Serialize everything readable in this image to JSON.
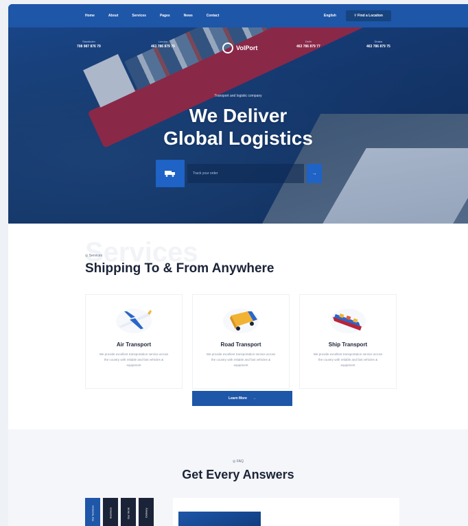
{
  "nav": {
    "items": [
      "Home",
      "About",
      "Services",
      "Pages",
      "News",
      "Contact"
    ],
    "language": "English",
    "cta": "Find a Location"
  },
  "contacts": [
    {
      "label": "Stockholm",
      "number": "708 987 876 79"
    },
    {
      "label": "London",
      "number": "463 786 879 79"
    },
    {
      "label": "Delhi",
      "number": "463 786 879 77"
    },
    {
      "label": "Dhaka",
      "number": "463 786 879 75"
    }
  ],
  "logo": {
    "name": "VolPort"
  },
  "hero": {
    "eyebrow": "Transport and logistic company",
    "headline_line1": "We Deliver",
    "headline_line2": "Global Logistics",
    "track_placeholder": "Track your order"
  },
  "services": {
    "ghost": "Services",
    "tag": "Services",
    "title": "Shipping To & From Anywhere",
    "cards": [
      {
        "title": "Air Transport",
        "desc": "We provide excellent transportation service across the country with reliable and fast vehicles & equipment"
      },
      {
        "title": "Road Transport",
        "desc": "We provide excellent transportation service across the country with reliable and fast vehicles & equipment"
      },
      {
        "title": "Ship Transport",
        "desc": "We provide excellent transportation service across the country with reliable and fast vehicles & equipment"
      }
    ],
    "learn_more": "Learn More"
  },
  "answers": {
    "tag": "FAQ",
    "title": "Get Every Answers",
    "tabs": [
      "Our Services",
      "Business",
      "Our Work",
      "Delivery"
    ]
  },
  "colors": {
    "brand": "#1e56a8",
    "dark": "#1b2338",
    "accent": "#1e63c5"
  }
}
